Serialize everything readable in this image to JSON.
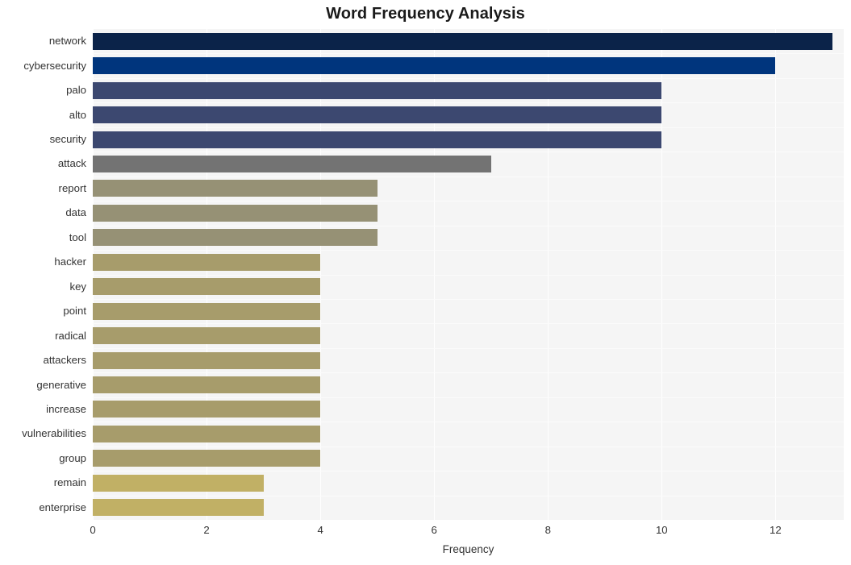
{
  "chart_data": {
    "type": "bar",
    "orientation": "horizontal",
    "title": "Word Frequency Analysis",
    "xlabel": "Frequency",
    "ylabel": "",
    "xlim": [
      0,
      13.2
    ],
    "ylim": [
      0,
      20
    ],
    "grid": true,
    "legend": null,
    "xticks": [
      "0",
      "2",
      "4",
      "6",
      "8",
      "10",
      "12"
    ],
    "xtick_values": [
      0,
      2,
      4,
      6,
      8,
      10,
      12
    ],
    "categories": [
      "network",
      "cybersecurity",
      "palo",
      "alto",
      "security",
      "attack",
      "report",
      "data",
      "tool",
      "hacker",
      "key",
      "point",
      "radical",
      "attackers",
      "generative",
      "increase",
      "vulnerabilities",
      "group",
      "remain",
      "enterprise"
    ],
    "values": [
      13,
      12,
      10,
      10,
      10,
      7,
      5,
      5,
      5,
      4,
      4,
      4,
      4,
      4,
      4,
      4,
      4,
      4,
      3,
      3
    ],
    "colors": [
      "#0b2349",
      "#00357d",
      "#3c4870",
      "#3c4870",
      "#3c4870",
      "#737373",
      "#969175",
      "#969175",
      "#969175",
      "#a79c6b",
      "#a79c6b",
      "#a79c6b",
      "#a79c6b",
      "#a79c6b",
      "#a79c6b",
      "#a79c6b",
      "#a79c6b",
      "#a79c6b",
      "#c1b065",
      "#c1b065"
    ],
    "plot_background": "#f5f5f5",
    "figure_background": "#ffffff",
    "gridline_color": "#ffffff"
  }
}
